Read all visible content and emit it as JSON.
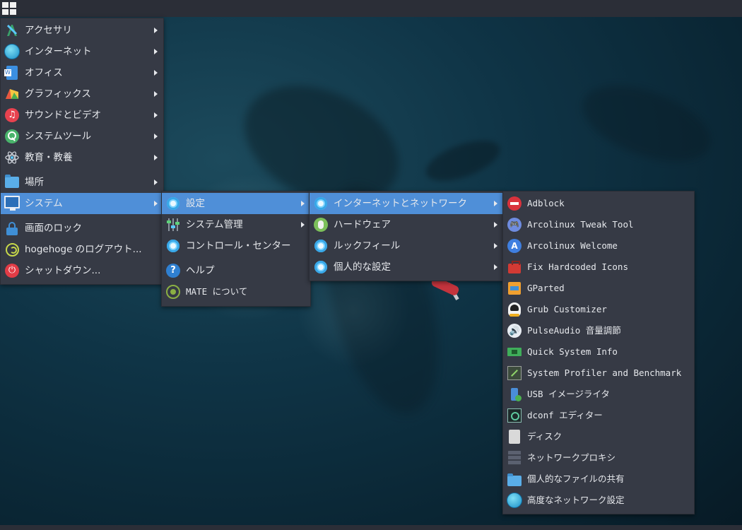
{
  "menu_main": [
    {
      "label": "アクセサリ",
      "icon": "accessories-icon",
      "arrow": true
    },
    {
      "label": "インターネット",
      "icon": "internet-globe-icon",
      "arrow": true
    },
    {
      "label": "オフィス",
      "icon": "office-icon",
      "arrow": true
    },
    {
      "label": "グラフィックス",
      "icon": "graphics-icon",
      "arrow": true
    },
    {
      "label": "サウンドとビデオ",
      "icon": "sound-video-icon",
      "arrow": true
    },
    {
      "label": "システムツール",
      "icon": "system-tools-icon",
      "arrow": true
    },
    {
      "label": "教育・教養",
      "icon": "education-atom-icon",
      "arrow": true
    },
    {
      "label": "場所",
      "icon": "folder-icon",
      "arrow": true
    },
    {
      "label": "システム",
      "icon": "monitor-icon",
      "arrow": true,
      "active": true
    },
    {
      "label": "画面のロック",
      "icon": "lock-icon",
      "arrow": false
    },
    {
      "label": "hogehoge のログアウト...",
      "icon": "logout-icon",
      "arrow": false
    },
    {
      "label": "シャットダウン...",
      "icon": "power-icon",
      "arrow": false
    }
  ],
  "menu_system": [
    {
      "label": "設定",
      "icon": "settings-gear-icon",
      "arrow": true,
      "active": true
    },
    {
      "label": "システム管理",
      "icon": "admin-sliders-icon",
      "arrow": true
    },
    {
      "label": "コントロール・センター",
      "icon": "control-center-gear-icon",
      "arrow": false
    },
    {
      "label": "ヘルプ",
      "icon": "help-icon",
      "arrow": false
    },
    {
      "label": "MATE について",
      "icon": "mate-logo-icon",
      "arrow": false
    }
  ],
  "menu_settings": [
    {
      "label": "インターネットとネットワーク",
      "icon": "network-gear-icon",
      "arrow": true,
      "active": true
    },
    {
      "label": "ハードウェア",
      "icon": "mouse-icon",
      "arrow": true
    },
    {
      "label": "ルックフィール",
      "icon": "appearance-gear-icon",
      "arrow": true
    },
    {
      "label": "個人的な設定",
      "icon": "personal-gear-icon",
      "arrow": true
    }
  ],
  "menu_network": [
    {
      "label": "Adblock",
      "icon": "adblock-icon"
    },
    {
      "label": "Arcolinux Tweak Tool",
      "icon": "gamepad-icon"
    },
    {
      "label": "Arcolinux Welcome",
      "icon": "arcolinux-icon"
    },
    {
      "label": "Fix Hardcoded Icons",
      "icon": "toolbox-icon"
    },
    {
      "label": "GParted",
      "icon": "gparted-icon"
    },
    {
      "label": "Grub Customizer",
      "icon": "tux-gear-icon"
    },
    {
      "label": "PulseAudio 音量調節",
      "icon": "speaker-icon"
    },
    {
      "label": "Quick System Info",
      "icon": "chip-icon"
    },
    {
      "label": "System Profiler and Benchmark",
      "icon": "benchmark-icon"
    },
    {
      "label": "USB イメージライタ",
      "icon": "usb-icon"
    },
    {
      "label": "dconf エディター",
      "icon": "dconf-icon"
    },
    {
      "label": "ディスク",
      "icon": "disk-icon"
    },
    {
      "label": "ネットワークプロキシ",
      "icon": "proxy-icon"
    },
    {
      "label": "個人的なファイルの共有",
      "icon": "shared-folder-icon"
    },
    {
      "label": "高度なネットワーク設定",
      "icon": "network-globe-icon"
    }
  ]
}
